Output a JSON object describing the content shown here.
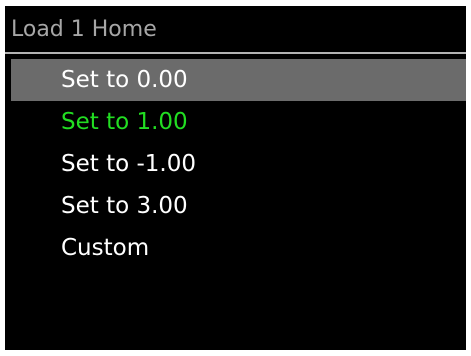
{
  "header": {
    "title": "Load 1 Home"
  },
  "menu": {
    "items": [
      {
        "label": "Set to 0.00",
        "color": "#ffffff",
        "selected": true
      },
      {
        "label": "Set to 1.00",
        "color": "#22dd22",
        "selected": false
      },
      {
        "label": "Set to -1.00",
        "color": "#ffffff",
        "selected": false
      },
      {
        "label": "Set to 3.00",
        "color": "#ffffff",
        "selected": false
      },
      {
        "label": "Custom",
        "color": "#ffffff",
        "selected": false
      }
    ]
  },
  "colors": {
    "background": "#000000",
    "selection_highlight": "#6b6b6b",
    "title_text": "#a6a6a6",
    "divider": "#b3b3b3",
    "active_value": "#22dd22"
  }
}
